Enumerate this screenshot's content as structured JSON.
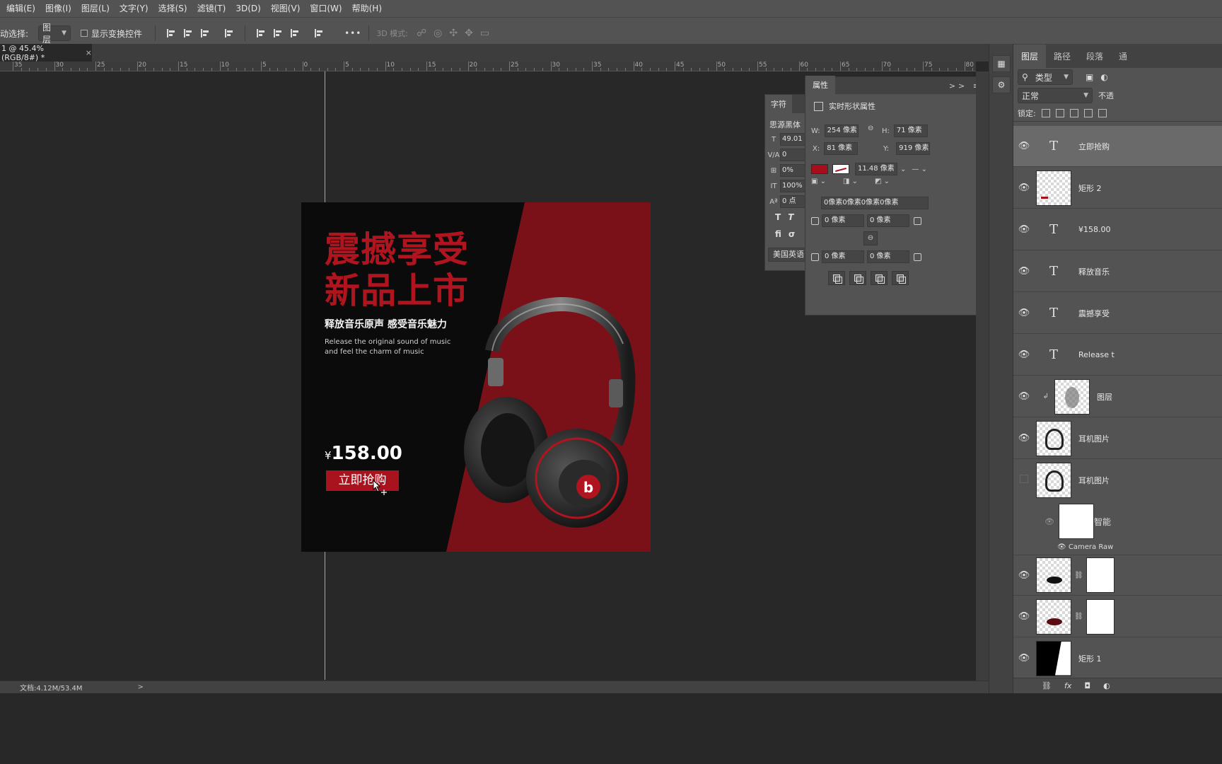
{
  "menu": [
    "编辑(E)",
    "图像(I)",
    "图层(L)",
    "文字(Y)",
    "选择(S)",
    "滤镜(T)",
    "3D(D)",
    "视图(V)",
    "窗口(W)",
    "帮助(H)"
  ],
  "options": {
    "auto_select_label": "动选择:",
    "auto_select_value": "图层",
    "show_transform_label": "显示变换控件",
    "more_label": "•••",
    "mode_3d_label": "3D 模式:"
  },
  "document_tab": {
    "title": "1 @ 45.4%(RGB/8#) *",
    "close": "×"
  },
  "ruler_ticks": [
    "35",
    "30",
    "25",
    "20",
    "15",
    "10",
    "5",
    "0",
    "5",
    "10",
    "15",
    "20",
    "25",
    "30",
    "35",
    "40",
    "45",
    "50",
    "55",
    "60",
    "65",
    "70",
    "75",
    "80"
  ],
  "artwork": {
    "title_line1": "震撼享受",
    "title_line2": "新品上市",
    "slogan": "释放音乐原声  感受音乐魅力",
    "english_line1": "Release the original sound of music",
    "english_line2": "and feel the charm of music",
    "currency": "¥",
    "price": "158.00",
    "buy_button": "立即抢购",
    "colors": {
      "red": "#a9131d",
      "dark": "#0b0b0b",
      "red_bg": "#7a1119"
    }
  },
  "char_panel": {
    "tab": "字符",
    "font": "思源黑体",
    "size": "49.01 p",
    "kerning": "0",
    "scale": "0%",
    "vscale": "100%",
    "baseline": "0 点",
    "language": "美国英语"
  },
  "props_panel": {
    "tab": "属性",
    "controls": ">> ≡",
    "subtitle": "实时形状属性",
    "w_label": "W:",
    "w_value": "254 像素",
    "h_label": "H:",
    "h_value": "71 像素",
    "x_label": "X:",
    "x_value": "81 像素",
    "y_label": "Y:",
    "y_value": "919 像素",
    "stroke_width": "11.48 像素",
    "corner_all": "0像素0像素0像素0像素",
    "corner_tl": "0 像素",
    "corner_tr": "0 像素",
    "corner_bl": "0 像素",
    "corner_br": "0 像素"
  },
  "layers_panel": {
    "tabs": [
      "图层",
      "路径",
      "段落",
      "通"
    ],
    "filter_label": "类型",
    "blend_mode": "正常",
    "opacity_label": "不透",
    "lock_label": "锁定:",
    "layers": [
      {
        "name": "立即抢购",
        "type": "text",
        "visible": true,
        "selected": true
      },
      {
        "name": "矩形 2",
        "type": "shape",
        "visible": true
      },
      {
        "name": "¥158.00",
        "type": "text",
        "visible": true
      },
      {
        "name": "释放音乐",
        "type": "text",
        "visible": true
      },
      {
        "name": "震撼享受",
        "type": "text",
        "visible": true
      },
      {
        "name": "Release t",
        "type": "text",
        "visible": true
      },
      {
        "name": "图层",
        "type": "image",
        "visible": true
      },
      {
        "name": "耳机图片",
        "type": "image",
        "visible": true
      },
      {
        "name": "耳机图片",
        "type": "smart",
        "visible": false
      },
      {
        "name": "智能",
        "type": "filter",
        "visible": true
      },
      {
        "name": "",
        "type": "masked",
        "visible": true
      },
      {
        "name": "",
        "type": "masked",
        "visible": true
      },
      {
        "name": "矩形 1",
        "type": "shape",
        "visible": true
      }
    ],
    "camera_raw": "Camera Raw"
  },
  "status": {
    "doc_info": "文档:4.12M/53.4M",
    "arrow": ">"
  }
}
